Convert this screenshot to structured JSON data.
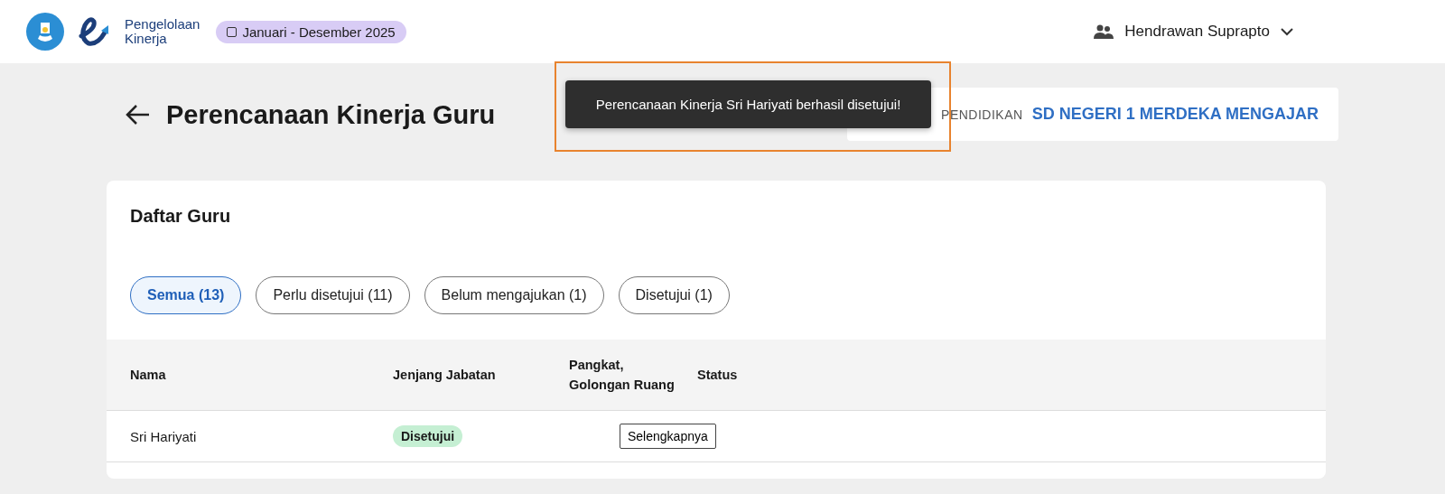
{
  "header": {
    "logo_text": "Pengelolaan\nKinerja",
    "period": "Januari - Desember 2025",
    "user": "Hendrawan Suprapto"
  },
  "page": {
    "title": "Perencanaan Kinerja Guru",
    "info_label": "PENDIDIKAN",
    "info_value": "SD NEGERI 1 MERDEKA MENGAJAR"
  },
  "toast": {
    "message": "Perencanaan Kinerja Sri Hariyati berhasil disetujui!"
  },
  "card": {
    "title": "Daftar Guru",
    "filters": [
      {
        "label": "Semua (13)",
        "selected": true
      },
      {
        "label": "Perlu disetujui (11)",
        "selected": false
      },
      {
        "label": "Belum mengajukan (1)",
        "selected": false
      },
      {
        "label": "Disetujui (1)",
        "selected": false
      }
    ],
    "columns": [
      "Nama",
      "Jenjang Jabatan",
      "Pangkat,\nGolongan Ruang",
      "Status"
    ],
    "rows": [
      {
        "name": "Sri Hariyati",
        "status": "Disetujui",
        "action": "Selengkapnya"
      }
    ]
  }
}
